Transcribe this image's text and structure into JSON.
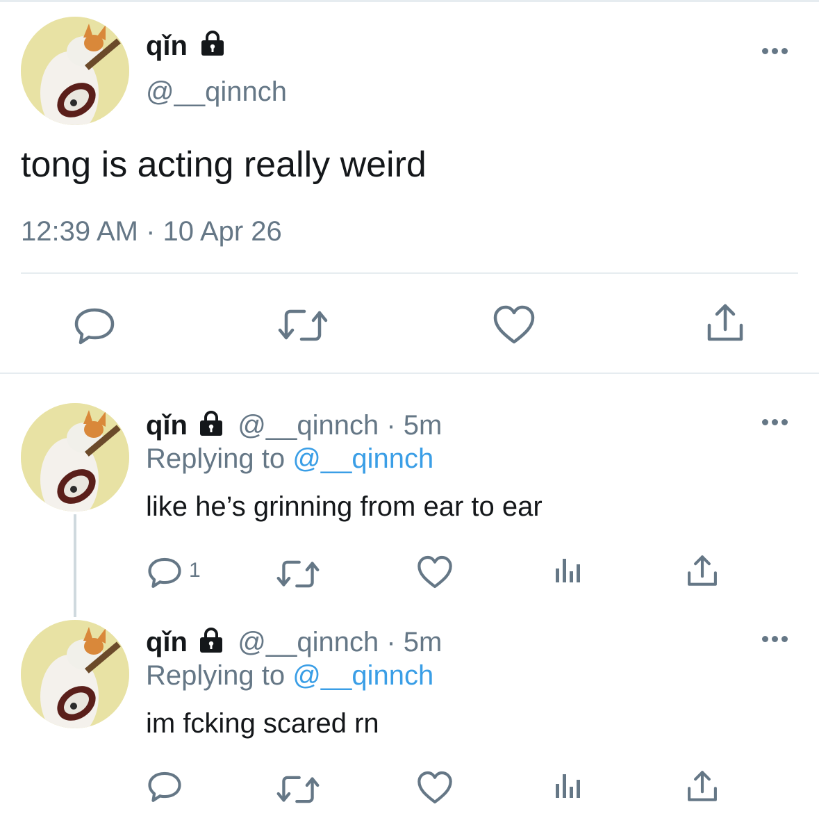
{
  "main_tweet": {
    "display_name": "qǐn",
    "handle": "@__qinnch",
    "text": "tong is acting really weird",
    "timestamp": "12:39 AM · 10 Apr 26"
  },
  "replies": [
    {
      "display_name": "qǐn",
      "meta": "@__qinnch · 5m",
      "replying_prefix": "Replying to",
      "replying_handle": "@__qinnch",
      "text": "like he’s grinning from ear to ear",
      "reply_count": "1"
    },
    {
      "display_name": "qǐn",
      "meta": "@__qinnch · 5m",
      "replying_prefix": "Replying to",
      "replying_handle": "@__qinnch",
      "text": "im fcking scared rn",
      "reply_count": ""
    }
  ],
  "icons": {
    "reply": "speech-bubble-icon",
    "retweet": "retweet-arrows-icon",
    "like": "heart-outline-icon",
    "analytics": "bar-chart-icon",
    "share": "share-upload-icon",
    "more": "ellipsis-icon",
    "protected": "padlock-icon"
  },
  "colors": {
    "text": "#14171a",
    "muted": "#657786",
    "link": "#3a9ee6",
    "divider": "#e6ecf0"
  }
}
